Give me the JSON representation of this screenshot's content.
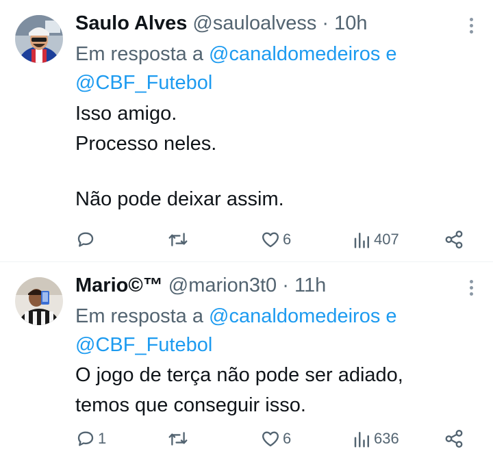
{
  "tweets": [
    {
      "name": "Saulo Alves",
      "handle": "@sauloalvess",
      "separator": "·",
      "time": "10h",
      "reply_prefix": "Em resposta a",
      "mention_1": "@canaldomedeiros",
      "conjunction": "e",
      "mention_2": "@CBF_Futebol",
      "text_lines": [
        "Isso amigo.",
        "Processo neles.",
        "",
        "Não pode deixar assim."
      ],
      "replies": "",
      "retweets": "",
      "likes": "6",
      "views": "407"
    },
    {
      "name": "Mario©™",
      "handle": "@marion3t0",
      "separator": "·",
      "time": "11h",
      "reply_prefix": "Em resposta a",
      "mention_1": "@canaldomedeiros",
      "conjunction": "e",
      "mention_2": "@CBF_Futebol",
      "text_lines": [
        "O jogo de terça não pode ser adiado,",
        "temos que conseguir isso."
      ],
      "replies": "1",
      "retweets": "",
      "likes": "6",
      "views": "636"
    }
  ],
  "icons": {
    "reply": "reply-icon",
    "retweet": "retweet-icon",
    "like": "heart-icon",
    "views": "views-icon",
    "share": "share-icon",
    "more": "more-icon"
  },
  "colors": {
    "link": "#1d9bf0",
    "secondary_text": "#536471",
    "primary_text": "#0f1419"
  }
}
